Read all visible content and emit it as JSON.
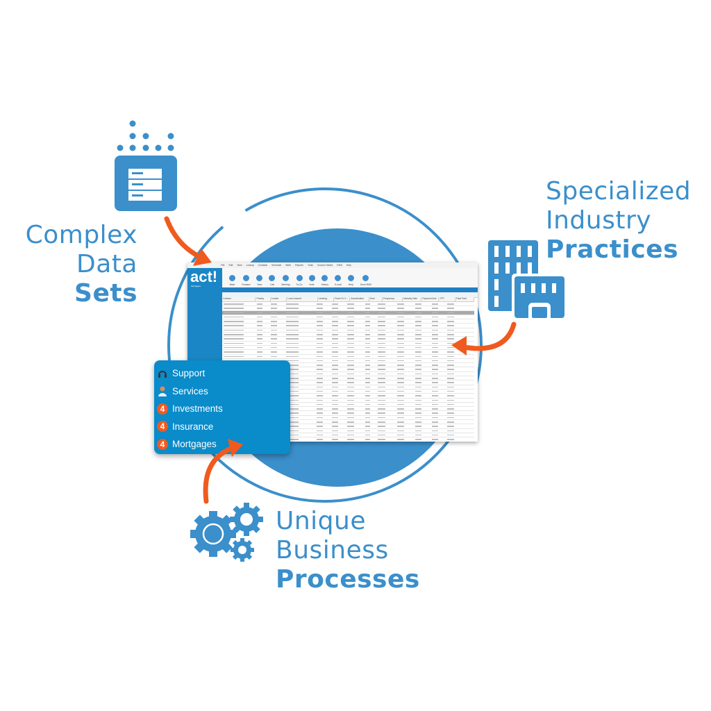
{
  "colors": {
    "brand_blue": "#3b8fcb",
    "accent_orange": "#f05a1e",
    "menu_blue": "#0a8bca"
  },
  "labels": {
    "complex": {
      "line1": "Complex",
      "line2": "Data",
      "bold": "Sets",
      "icon": "data-server-icon"
    },
    "industry": {
      "line1": "Specialized",
      "line2": "Industry",
      "bold": "Practices",
      "icon": "buildings-icon"
    },
    "business": {
      "line1": "Unique",
      "line2": "Business",
      "bold": "Processes",
      "icon": "gears-icon"
    }
  },
  "app": {
    "logo": "act!",
    "logo_sub": "Mortgages",
    "menu": [
      "File",
      "Edit",
      "View",
      "Lookup",
      "Contacts",
      "Schedule",
      "Write",
      "Reports",
      "Tools",
      "Custom Tables",
      "RMS",
      "Help"
    ],
    "toolbar": [
      "Back",
      "Forward",
      "New",
      "Call",
      "Meeting",
      "To-Do",
      "Note",
      "History",
      "E-mail",
      "Help",
      "Send RMS"
    ],
    "columns": [
      "Contact",
      "Priority",
      "Lender",
      "Loan Amount",
      "Lending",
      "Fixed Or V...",
      "Amortization",
      "Term",
      "Frequency",
      "Maturity Date",
      "Payment Amt",
      "PPT",
      "Total Paid"
    ]
  },
  "popup_menu": [
    {
      "label": "Support",
      "icon": "headset-icon"
    },
    {
      "label": "Services",
      "icon": "person-icon"
    },
    {
      "label": "Investments",
      "icon": "four-badge-icon"
    },
    {
      "label": "Insurance",
      "icon": "four-badge-icon"
    },
    {
      "label": "Mortgages",
      "icon": "four-badge-icon"
    }
  ],
  "badge_glyph": "4"
}
